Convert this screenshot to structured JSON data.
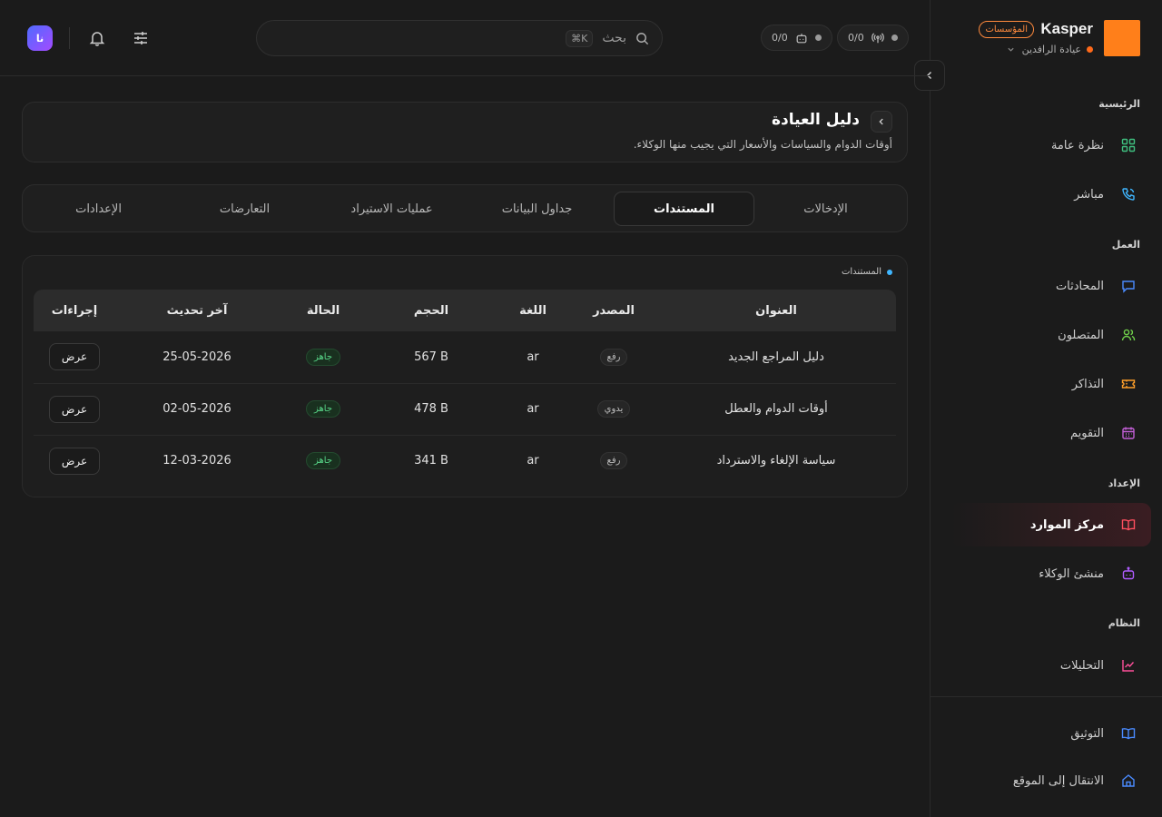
{
  "brand": {
    "name": "Kasper",
    "badge": "المؤسسات",
    "org": "عيادة الرافدين",
    "logo_color": "#ff7f1a"
  },
  "sidebar": {
    "sections": [
      {
        "title": "الرئيسية"
      },
      {
        "title": "العمل"
      },
      {
        "title": "الإعداد"
      },
      {
        "title": "النظام"
      }
    ],
    "items": [
      {
        "label": "نظرة عامة",
        "icon": "grid-icon",
        "color": "#3fbf7f"
      },
      {
        "label": "مباشر",
        "icon": "phone-icon",
        "color": "#3fb6ff"
      },
      {
        "label": "المحادثات",
        "icon": "chat-icon",
        "color": "#4a8bff"
      },
      {
        "label": "المتصلون",
        "icon": "users-icon",
        "color": "#6fce4a"
      },
      {
        "label": "التذاكر",
        "icon": "ticket-icon",
        "color": "#ff9f2a"
      },
      {
        "label": "التقويم",
        "icon": "calendar-icon",
        "color": "#c25fd6"
      },
      {
        "label": "مركز الموارد",
        "icon": "book-icon",
        "color": "#ff4f5f",
        "active": true
      },
      {
        "label": "منشئ الوكلاء",
        "icon": "bot-icon",
        "color": "#b05cff"
      },
      {
        "label": "التحليلات",
        "icon": "chart-icon",
        "color": "#ff4f9a"
      }
    ],
    "footer": [
      {
        "label": "التوثيق",
        "icon": "book-icon",
        "color": "#4a8bff"
      },
      {
        "label": "الانتقال إلى الموقع",
        "icon": "home-icon",
        "color": "#4a8bff"
      }
    ]
  },
  "topbar": {
    "pill_calls": "0/0",
    "pill_bots": "0/0",
    "search_placeholder": "بحث",
    "search_shortcut": "⌘K",
    "avatar_initials": "نا"
  },
  "header": {
    "title": "دليل العيادة",
    "subtitle": "أوقات الدوام والسياسات والأسعار التي يجيب منها الوكلاء."
  },
  "tabs": [
    {
      "label": "الإدخالات"
    },
    {
      "label": "المستندات",
      "active": true
    },
    {
      "label": "جداول البيانات"
    },
    {
      "label": "عمليات الاستيراد"
    },
    {
      "label": "التعارضات"
    },
    {
      "label": "الإعدادات"
    }
  ],
  "documents": {
    "label": "المستندات",
    "columns": [
      "العنوان",
      "المصدر",
      "اللغة",
      "الحجم",
      "الحالة",
      "آخر تحديث",
      "إجراءات"
    ],
    "rows": [
      {
        "title": "دليل المراجع الجديد",
        "source": "رفع",
        "lang": "ar",
        "size": "567 B",
        "status": "جاهز",
        "updated": "25-05-2026",
        "action": "عرض"
      },
      {
        "title": "أوقات الدوام والعطل",
        "source": "يدوي",
        "lang": "ar",
        "size": "478 B",
        "status": "جاهز",
        "updated": "02-05-2026",
        "action": "عرض"
      },
      {
        "title": "سياسة الإلغاء والاسترداد",
        "source": "رفع",
        "lang": "ar",
        "size": "341 B",
        "status": "جاهز",
        "updated": "12-03-2026",
        "action": "عرض"
      }
    ]
  }
}
